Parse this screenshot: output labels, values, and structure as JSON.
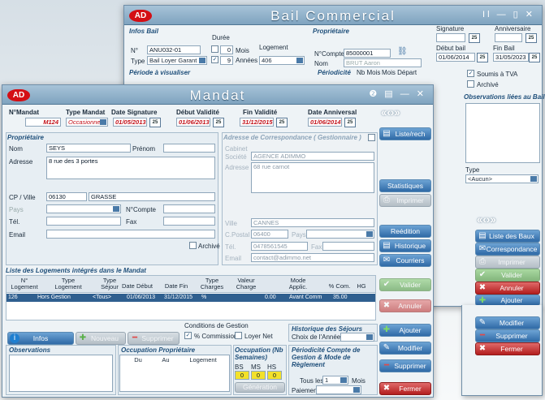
{
  "back": {
    "title": "Bail Commercial",
    "logo": "AD",
    "controls": "Il — ▯ ✕",
    "infos": {
      "section": "Infos Bail",
      "n_label": "N°",
      "n_value": "ANU032-01",
      "type_label": "Type",
      "type_value": "Bail Loyer Garant",
      "duree": "Durée",
      "mois_value": "0",
      "mois": "Mois",
      "annees_value": "9",
      "annees": "Années",
      "logement": "Logement",
      "logement_value": "406"
    },
    "proprietaire": {
      "section": "Propriétaire",
      "ncompte_label": "N°Compte",
      "ncompte_value": "85000001",
      "nom_label": "Nom",
      "nom_value": "BRUT Aaron"
    },
    "signature": "Signature",
    "anniversaire": "Anniversaire",
    "debut": "Début bail",
    "debut_value": "01/06/2014",
    "fin": "Fin Bail",
    "fin_value": "31/05/2023",
    "periode": {
      "section": "Période à visualiser",
      "periodicite": "Périodicité",
      "nb_mois": "Nb Mois",
      "mois_depart": "Mois Départ"
    },
    "tva": "Soumis à TVA",
    "archive": "Archivé",
    "observations": "Observations liées au Bail",
    "type_label": "Type",
    "type_value": "<Aucun>",
    "buttons": {
      "liste_baux": "Liste des Baux",
      "correspondance": "Correspondance",
      "imprimer": "Imprimer",
      "valider": "Valider",
      "annuler": "Annuler",
      "ajouter": "Ajouter",
      "modifier": "Modifier",
      "supprimer": "Supprimer",
      "fermer": "Fermer"
    }
  },
  "front": {
    "title": "Mandat",
    "logo": "AD",
    "controls": "❷ ▤ — ✕",
    "header": {
      "nmandat": "N°Mandat",
      "nmandat_value": "M124",
      "type_mandat": "Type Mandat",
      "type_mandat_value": "Occasionnel",
      "date_signature": "Date Signature",
      "date_signature_value": "01/05/2013",
      "debut_validite": "Début Validité",
      "debut_validite_value": "01/06/2013",
      "fin_validite": "Fin Validité",
      "fin_validite_value": "31/12/2015",
      "date_anniv": "Date Anniversal",
      "date_anniv_value": "01/06/2014"
    },
    "prop": {
      "section": "Propriétaire",
      "nom": "Nom",
      "nom_value": "SEYS",
      "prenom": "Prénom",
      "adresse": "Adresse",
      "adresse_value": "8 rue des 3 portes",
      "cp": "CP / Ville",
      "cp_value": "06130",
      "ville_value": "GRASSE",
      "pays": "Pays",
      "ncompte": "N°Compte",
      "tel": "Tél.",
      "fax": "Fax",
      "email": "Email",
      "archive": "Archivé"
    },
    "corr": {
      "section": "Adresse de Correspondance ( Gestionnaire )",
      "cabinet": "Cabinet",
      "societe": "Société",
      "societe_value": "AGENCE ADIMMO",
      "adresse": "Adresse",
      "adresse_value": "68 rue carnot",
      "ville": "Ville",
      "ville_value": "CANNES",
      "cpostal": "C.Postal",
      "cpostal_value": "06400",
      "pays": "Pays",
      "tel": "Tél.",
      "tel_value": "0478561545",
      "fax": "Fax",
      "email": "Email",
      "email_value": "contact@adimmo.net"
    },
    "table": {
      "section": "Liste des Logements intégrés dans le Mandat",
      "headers": [
        "N° Logement",
        "Type Logement",
        "Type Séjour",
        "Date Début",
        "Date Fin",
        "Type Charges",
        "Valeur Charge",
        "Mode Applic.",
        "% Com.",
        "HG"
      ],
      "row": [
        "126",
        "Hors Gestion",
        "<Tous>",
        "01/06/2013",
        "31/12/2015",
        "%",
        "0.00",
        "Avant Comm",
        "35.00"
      ]
    },
    "gestion": {
      "title": "Conditions de Gestion",
      "commission": "% Commission",
      "loyer_net": "Loyer Net"
    },
    "historique": {
      "title": "Historique des Séjours",
      "choix": "Choix de l'Année"
    },
    "bottom_btns": {
      "infos": "Infos",
      "nouveau": "Nouveau",
      "supprimer": "Supprimer"
    },
    "observations": "Observations",
    "occupation": {
      "title": "Occupation Propriétaire",
      "du": "Du",
      "au": "Au",
      "logement": "Logement"
    },
    "occ2": {
      "title": "Occupation (Nb Semaines)",
      "bs": "BS",
      "ms": "MS",
      "hs": "HS",
      "bs_value": "0",
      "ms_value": "0",
      "hs_value": "0",
      "generation": "Génération"
    },
    "periodicite": {
      "title": "Périodicité Compte de Gestion & Mode de Règlement",
      "tous": "Tous les",
      "tous_value": "1",
      "mois": "Mois",
      "paiement": "Paiement"
    },
    "side": {
      "liste": "Liste/rech",
      "statistiques": "Statistiques",
      "imprimer": "Imprimer",
      "reedition": "Reédition",
      "historique": "Historique",
      "courriers": "Courriers",
      "valider": "Valider",
      "annuler": "Annuler",
      "ajouter": "Ajouter",
      "modifier": "Modifier",
      "supprimer": "Supprimer",
      "fermer": "Fermer"
    }
  }
}
